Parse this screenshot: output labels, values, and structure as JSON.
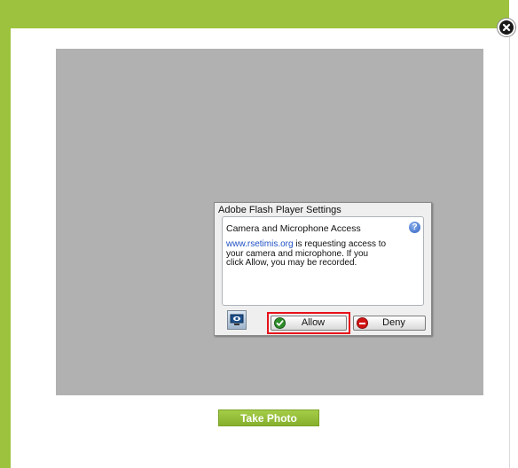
{
  "colors": {
    "brand_green": "#9dc33e",
    "camera_gray": "#b1b1b1",
    "highlight_red": "#e8121b",
    "link_blue": "#1f4fc2"
  },
  "close_button": {
    "icon": "close-icon"
  },
  "flash_dialog": {
    "title": "Adobe Flash Player Settings",
    "heading": "Camera and Microphone Access",
    "help_icon": {
      "icon": "help-icon",
      "symbol": "?"
    },
    "message": {
      "link": "www.rsetimis.org",
      "line1_rest": " is requesting access to",
      "line2": "your camera and microphone. If you",
      "line3": "click Allow, you may be recorded."
    },
    "settings_icon": "camera-settings-icon",
    "allow_button": {
      "label": "Allow",
      "icon": "check-circle-icon"
    },
    "deny_button": {
      "label": "Deny",
      "icon": "no-entry-icon"
    }
  },
  "take_photo_button": {
    "label": "Take Photo"
  }
}
